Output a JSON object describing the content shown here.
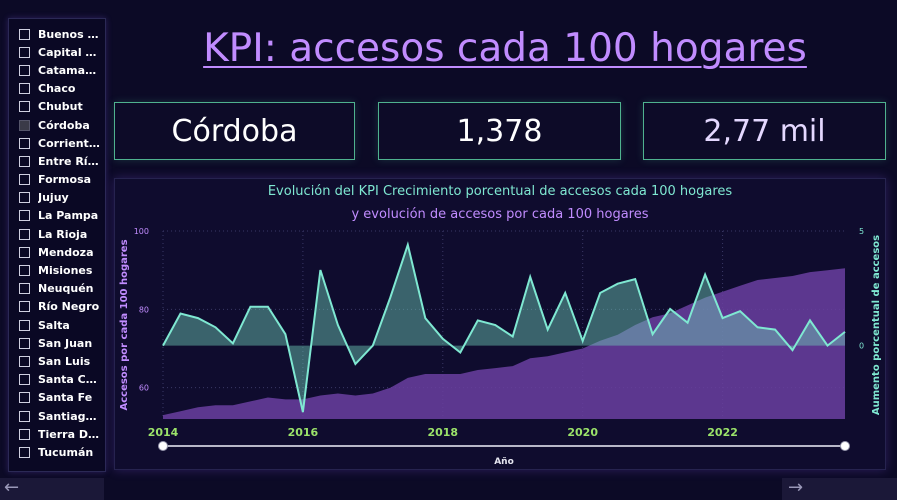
{
  "page": {
    "title": "KPI: accesos cada 100 hogares"
  },
  "slicer": {
    "items": [
      {
        "label": "Buenos A...",
        "checked": false
      },
      {
        "label": "Capital F...",
        "checked": false
      },
      {
        "label": "Catamarca",
        "checked": false
      },
      {
        "label": "Chaco",
        "checked": false
      },
      {
        "label": "Chubut",
        "checked": false
      },
      {
        "label": "Córdoba",
        "checked": true
      },
      {
        "label": "Corrientes",
        "checked": false
      },
      {
        "label": "Entre Ríos",
        "checked": false
      },
      {
        "label": "Formosa",
        "checked": false
      },
      {
        "label": "Jujuy",
        "checked": false
      },
      {
        "label": "La Pampa",
        "checked": false
      },
      {
        "label": "La Rioja",
        "checked": false
      },
      {
        "label": "Mendoza",
        "checked": false
      },
      {
        "label": "Misiones",
        "checked": false
      },
      {
        "label": "Neuquén",
        "checked": false
      },
      {
        "label": "Río Negro",
        "checked": false
      },
      {
        "label": "Salta",
        "checked": false
      },
      {
        "label": "San Juan",
        "checked": false
      },
      {
        "label": "San Luis",
        "checked": false
      },
      {
        "label": "Santa Cruz",
        "checked": false
      },
      {
        "label": "Santa Fe",
        "checked": false
      },
      {
        "label": "Santiago ...",
        "checked": false
      },
      {
        "label": "Tierra De...",
        "checked": false
      },
      {
        "label": "Tucumán",
        "checked": false
      }
    ]
  },
  "cards": {
    "province": "Córdoba",
    "value1": "1,378",
    "value2": "2,77 mil"
  },
  "nav": {
    "prev_icon": "arrow-left-icon",
    "next_icon": "arrow-right-icon"
  },
  "colors": {
    "area_purple": "#6a3fa0",
    "line_teal": "#7fe8d2",
    "title_teal": "#7fe8d2",
    "title_purple": "#c18cff",
    "tick_green": "#9be36a"
  },
  "chart_data": {
    "type": "area",
    "title_line1": "Evolución del KPI Crecimiento porcentual de accesos cada 100 hogares",
    "title_line2": "y evolución de accesos por cada 100 hogares",
    "xlabel": "Año",
    "ylabel_left": "Accesos por cada 100 hogares",
    "ylabel_right": "Aumento porcentual de accesos",
    "x_ticks": [
      "2014",
      "2016",
      "2018",
      "2020",
      "2022"
    ],
    "y_left_ticks": [
      "60",
      "80",
      "100"
    ],
    "y_right_ticks": [
      "0",
      "5"
    ],
    "y_left_range": [
      52,
      100
    ],
    "y_right_range": [
      -3.2,
      5
    ],
    "grid": true,
    "x_range": [
      2014.0,
      2023.75
    ],
    "series": [
      {
        "name": "Accesos por cada 100 hogares",
        "axis": "left",
        "x": [
          2014.0,
          2014.25,
          2014.5,
          2014.75,
          2015.0,
          2015.25,
          2015.5,
          2015.75,
          2016.0,
          2016.25,
          2016.5,
          2016.75,
          2017.0,
          2017.25,
          2017.5,
          2017.75,
          2018.0,
          2018.25,
          2018.5,
          2018.75,
          2019.0,
          2019.25,
          2019.5,
          2019.75,
          2020.0,
          2020.25,
          2020.5,
          2020.75,
          2021.0,
          2021.25,
          2021.5,
          2021.75,
          2022.0,
          2022.25,
          2022.5,
          2022.75,
          2023.0,
          2023.25,
          2023.5,
          2023.75
        ],
        "values": [
          53,
          54,
          55,
          55.5,
          55.5,
          56.5,
          57.5,
          57,
          57,
          58,
          58.5,
          58,
          58.5,
          60,
          62.5,
          63.5,
          63.5,
          63.5,
          64.5,
          65,
          65.5,
          67.5,
          68,
          69,
          70,
          72,
          73.5,
          76,
          78,
          79,
          81,
          83,
          84.5,
          86,
          87.5,
          88,
          88.5,
          89.5,
          90,
          90.5
        ]
      },
      {
        "name": "Aumento porcentual de accesos",
        "axis": "right",
        "x": [
          2014.0,
          2014.25,
          2014.5,
          2014.75,
          2015.0,
          2015.25,
          2015.5,
          2015.75,
          2016.0,
          2016.25,
          2016.5,
          2016.75,
          2017.0,
          2017.25,
          2017.5,
          2017.75,
          2018.0,
          2018.25,
          2018.5,
          2018.75,
          2019.0,
          2019.25,
          2019.5,
          2019.75,
          2020.0,
          2020.25,
          2020.5,
          2020.75,
          2021.0,
          2021.25,
          2021.5,
          2021.75,
          2022.0,
          2022.25,
          2022.5,
          2022.75,
          2023.0,
          2023.25,
          2023.5,
          2023.75
        ],
        "values": [
          0,
          1.4,
          1.2,
          0.8,
          0.1,
          1.7,
          1.7,
          0.5,
          -2.9,
          3.3,
          0.9,
          -0.8,
          0,
          2.1,
          4.4,
          1.2,
          0.3,
          -0.3,
          1.1,
          0.9,
          0.4,
          3.0,
          0.7,
          2.3,
          0.2,
          2.3,
          2.7,
          2.9,
          0.5,
          1.6,
          1.0,
          3.1,
          1.2,
          1.5,
          0.8,
          0.7,
          -0.2,
          1.1,
          0,
          0.6
        ]
      }
    ]
  }
}
